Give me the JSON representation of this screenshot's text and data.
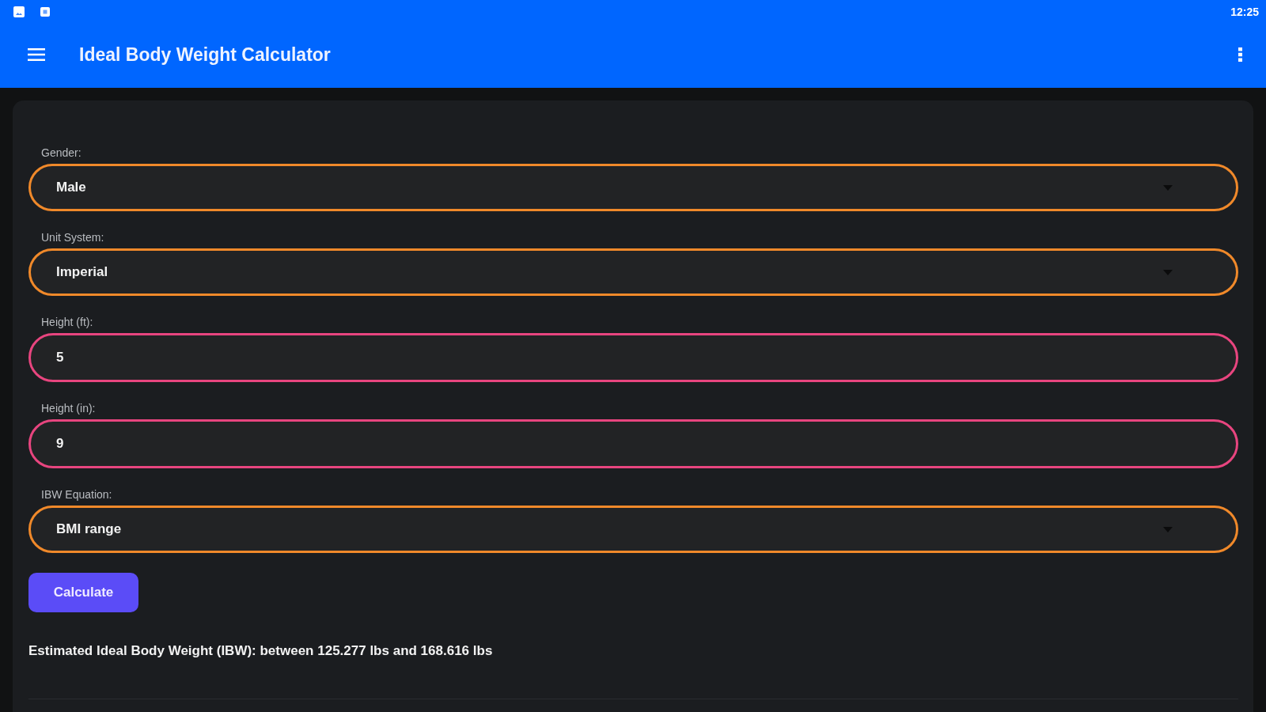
{
  "status_bar": {
    "time": "12:25"
  },
  "app_bar": {
    "title": "Ideal Body Weight Calculator"
  },
  "form": {
    "fields": [
      {
        "kind": "select",
        "label": "Gender:",
        "value": "Male"
      },
      {
        "kind": "select",
        "label": "Unit System:",
        "value": "Imperial"
      },
      {
        "kind": "input",
        "label": "Height (ft):",
        "value": "5"
      },
      {
        "kind": "input",
        "label": "Height (in):",
        "value": "9"
      },
      {
        "kind": "select",
        "label": "IBW Equation:",
        "value": "BMI range"
      }
    ],
    "calculate_button": "Calculate",
    "result": "Estimated Ideal Body Weight (IBW): between 125.277 lbs and 168.616 lbs"
  }
}
